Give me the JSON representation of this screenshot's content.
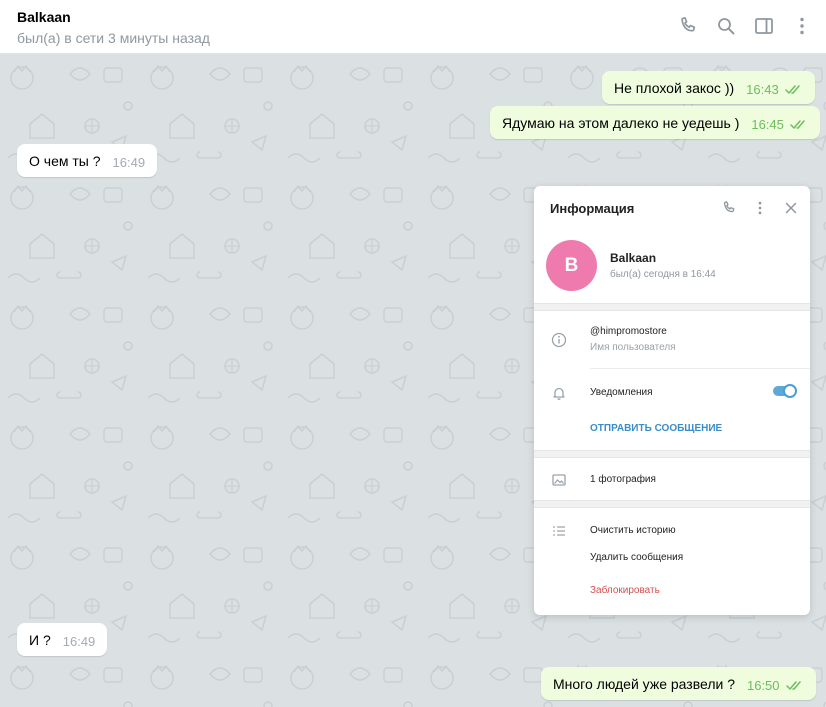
{
  "header": {
    "title": "Balkaan",
    "status": "был(а) в сети 3 минуты назад"
  },
  "messages": [
    {
      "direction": "out",
      "text": "Не плохой закос ))",
      "time": "16:43",
      "read": true
    },
    {
      "direction": "out",
      "text": "Ядумаю на этом далеко не уедешь )",
      "time": "16:45",
      "read": true
    },
    {
      "direction": "in",
      "text": "О чем ты ?",
      "time": "16:49"
    },
    {
      "direction": "in",
      "text": "И ?",
      "time": "16:49"
    },
    {
      "direction": "out",
      "text": "Много людей уже развели ?",
      "time": "16:50",
      "read": true
    }
  ],
  "info_panel": {
    "title": "Информация",
    "avatar_letter": "B",
    "avatar_color": "#ee7aae",
    "name": "Balkaan",
    "status": "был(а) сегодня в 16:44",
    "username": "@himpromostore",
    "username_label": "Имя пользователя",
    "notifications_label": "Уведомления",
    "notifications_on": true,
    "send_message_label": "ОТПРАВИТЬ СООБЩЕНИЕ",
    "photos_label": "1 фотография",
    "clear_history_label": "Очистить историю",
    "delete_messages_label": "Удалить сообщения",
    "block_label": "Заблокировать"
  },
  "colors": {
    "outgoing_bubble": "#effdde",
    "incoming_bubble": "#ffffff",
    "chat_background": "#dbe0e3",
    "accent": "#5fa9d8",
    "danger": "#d25050"
  }
}
